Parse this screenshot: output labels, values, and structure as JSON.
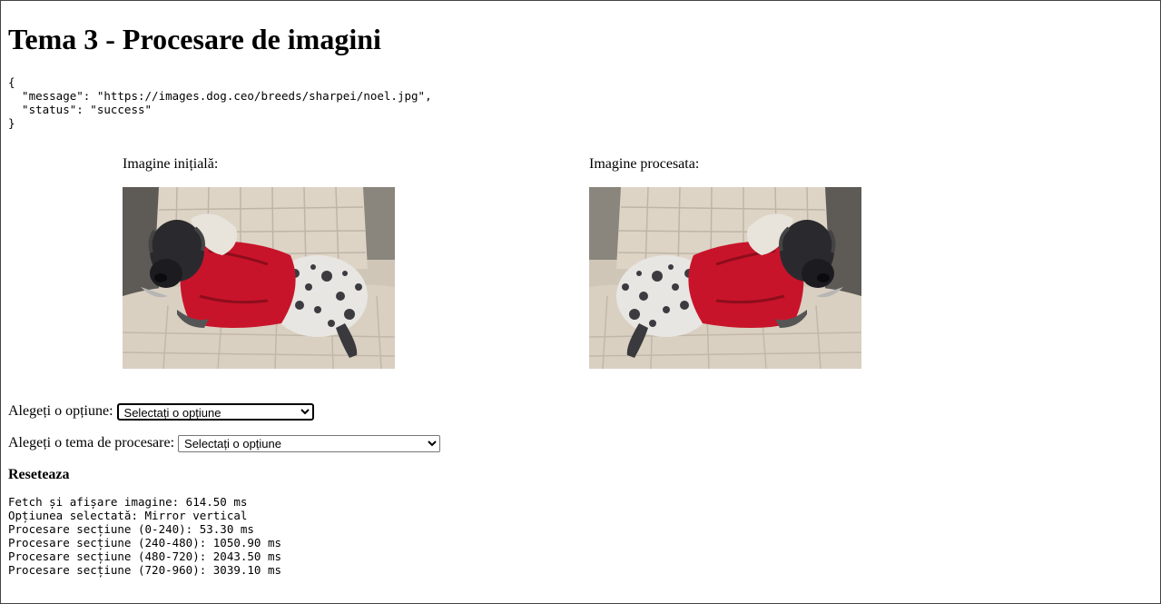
{
  "page": {
    "title": "Tema 3 - Procesare de imagini"
  },
  "api_response": {
    "text": "{\n  \"message\": \"https://images.dog.ceo/breeds/sharpei/noel.jpg\",\n  \"status\": \"success\"\n}"
  },
  "images": {
    "original_label": "Imagine inițială:",
    "processed_label": "Imagine procesata:",
    "processing": "mirror-vertical"
  },
  "controls": {
    "option_label": "Alegeți o opțiune:",
    "option_selected": "Selectați o opțiune",
    "theme_label": "Alegeți o tema de procesare:",
    "theme_selected": "Selectați o opțiune",
    "reset_label": "Reseteaza"
  },
  "log": {
    "lines": [
      "Fetch și afișare imagine: 614.50 ms",
      "Opțiunea selectată: Mirror vertical",
      "Procesare secțiune (0-240): 53.30 ms",
      "Procesare secțiune (240-480): 1050.90 ms",
      "Procesare secțiune (480-720): 2043.50 ms",
      "Procesare secțiune (720-960): 3039.10 ms"
    ]
  },
  "colors": {
    "sweater": "#c8142a",
    "couch": "#d6cdbf",
    "dog_dark": "#2a2a2e"
  }
}
